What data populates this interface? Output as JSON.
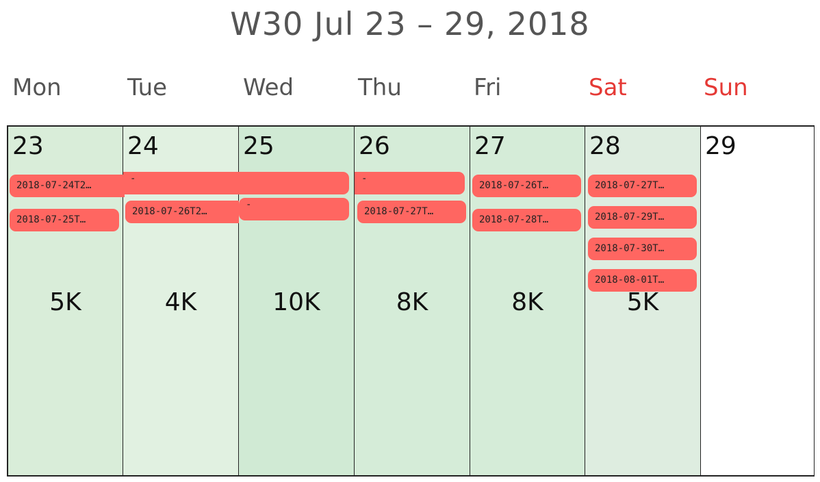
{
  "title": "W30 Jul 23 – 29, 2018",
  "weekdays": [
    "Mon",
    "Tue",
    "Wed",
    "Thu",
    "Fri",
    "Sat",
    "Sun"
  ],
  "colors": {
    "weekend_header": "#e53935",
    "event": "#ff6661",
    "cell_scale": [
      "#d9edd9",
      "#e1f1e1",
      "#d0ead4",
      "#d5ecd8",
      "#d5ecd8",
      "#deede0",
      "#ffffff"
    ]
  },
  "days": [
    {
      "date": "23",
      "total": "5K",
      "level": 5
    },
    {
      "date": "24",
      "total": "4K",
      "level": 4
    },
    {
      "date": "25",
      "total": "10K",
      "level": 10
    },
    {
      "date": "26",
      "total": "8K",
      "level": 8
    },
    {
      "date": "27",
      "total": "8K",
      "level": 8
    },
    {
      "date": "28",
      "total": "5K",
      "level": 5
    },
    {
      "date": "29",
      "total": "",
      "level": 0
    }
  ],
  "events": [
    {
      "label": "2018-07-24T2…"
    },
    {
      "label": "2018-07-25T…"
    },
    {
      "label": "-"
    },
    {
      "label": "2018-07-26T2…"
    },
    {
      "label": "-"
    },
    {
      "label": "-"
    },
    {
      "label": "2018-07-27T…"
    },
    {
      "label": "2018-07-26T…"
    },
    {
      "label": "2018-07-28T…"
    },
    {
      "label": "2018-07-27T…"
    },
    {
      "label": "2018-07-29T…"
    },
    {
      "label": "2018-07-30T…"
    },
    {
      "label": "2018-08-01T…"
    }
  ]
}
